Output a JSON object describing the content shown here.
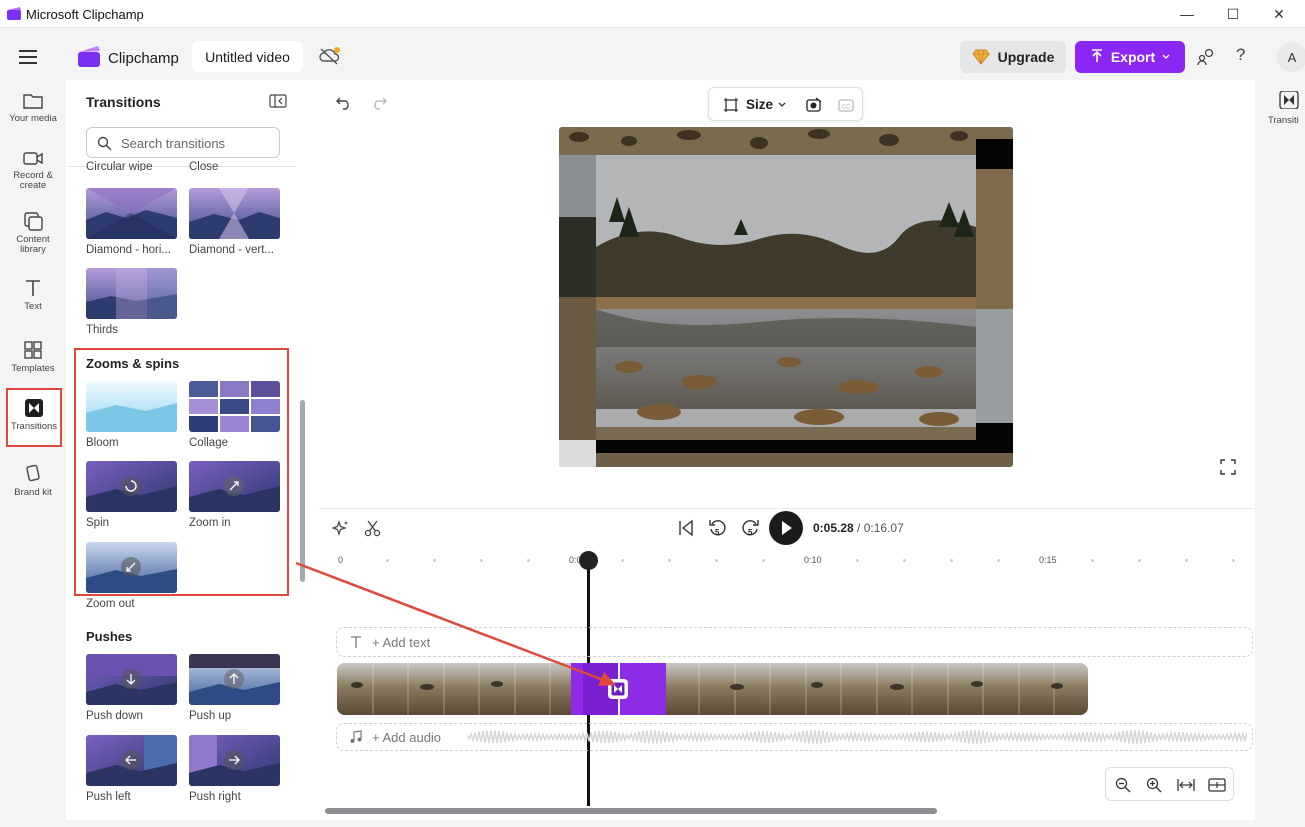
{
  "window": {
    "title": "Microsoft Clipchamp",
    "minimize": "—",
    "maximize": "☐",
    "close": "✕"
  },
  "header": {
    "app_name": "Clipchamp",
    "video_title": "Untitled video",
    "upgrade_label": "Upgrade",
    "export_label": "Export",
    "help_label": "?",
    "avatar_initial": "A",
    "export_color": "#8c27f3"
  },
  "left_nav": {
    "items": [
      {
        "label": "Your media",
        "icon": "folder-icon"
      },
      {
        "label": "Record & create",
        "icon": "camera-icon"
      },
      {
        "label": "Content library",
        "icon": "library-icon"
      },
      {
        "label": "Text",
        "icon": "text-icon"
      },
      {
        "label": "Templates",
        "icon": "templates-icon"
      },
      {
        "label": "Transitions",
        "icon": "transitions-icon",
        "selected": true
      },
      {
        "label": "Brand kit",
        "icon": "brand-kit-icon"
      }
    ]
  },
  "panel": {
    "title": "Transitions",
    "search_placeholder": "Search transitions",
    "partial_labels": [
      "Circular wipe",
      "Close"
    ],
    "groups": [
      {
        "items": [
          "Diamond - hori...",
          "Diamond - vert...",
          "Thirds"
        ]
      },
      {
        "heading": "Zooms & spins",
        "highlighted": true,
        "items": [
          "Bloom",
          "Collage",
          "Spin",
          "Zoom in",
          "Zoom out"
        ]
      },
      {
        "heading": "Pushes",
        "items": [
          "Push down",
          "Push up",
          "Push left",
          "Push right"
        ]
      }
    ]
  },
  "preview_toolbar": {
    "size_label": "Size"
  },
  "playback": {
    "current": "0:05.28",
    "separator": " / ",
    "total": "0:16.07",
    "skip_back": "5",
    "skip_fwd": "5"
  },
  "ruler": {
    "ticks": [
      "0",
      "0:05",
      "0:10",
      "0:15"
    ]
  },
  "timeline": {
    "add_text": "+ Add text",
    "add_audio": "+ Add audio",
    "playhead_seconds": 5.28
  },
  "right_nav": {
    "label": "Transiti"
  },
  "annotation_color": "#e0483b"
}
